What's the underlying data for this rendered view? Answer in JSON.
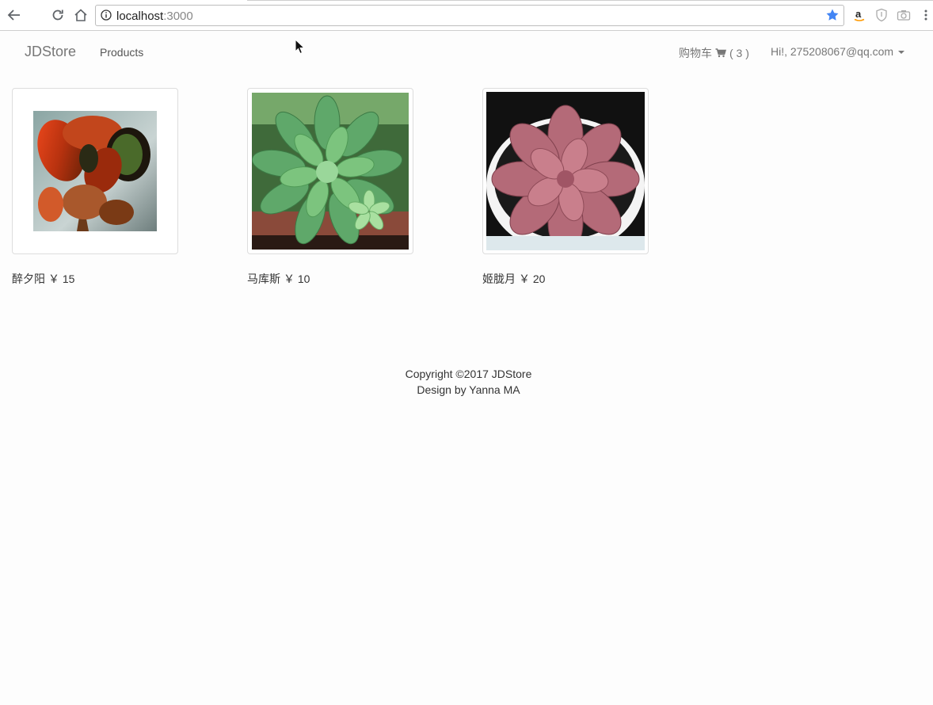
{
  "browser": {
    "url_host": "localhost",
    "url_port": ":3000"
  },
  "navbar": {
    "brand": "JDStore",
    "products_label": "Products",
    "cart_label": "购物车",
    "cart_count": "( 3 )",
    "user_label": "Hi!, 275208067@qq.com"
  },
  "products": [
    {
      "name": "醉夕阳",
      "price": "￥ 15"
    },
    {
      "name": "马库斯",
      "price": "￥ 10"
    },
    {
      "name": "姬胧月",
      "price": "￥ 20"
    }
  ],
  "footer": {
    "copyright": "Copyright ©2017 JDStore",
    "design": "Design by Yanna MA"
  },
  "colors": {
    "star": "#4285f4",
    "muted": "#777777"
  }
}
